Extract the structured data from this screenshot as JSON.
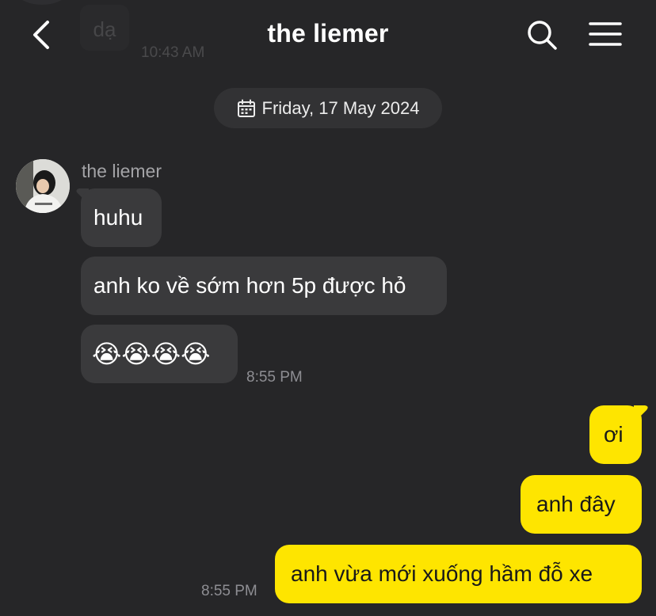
{
  "header": {
    "title": "the liemer",
    "icons": {
      "back": "chevron-left-icon",
      "search": "search-icon",
      "menu": "hamburger-menu-icon"
    }
  },
  "previous_message": {
    "text": "dạ",
    "time": "10:43 AM"
  },
  "date_separator": {
    "icon": "calendar-icon",
    "text": "Friday, 17 May 2024"
  },
  "incoming": {
    "sender": "the liemer",
    "messages": [
      {
        "text": "huhu"
      },
      {
        "text": "anh ko về sớm hơn 5p được hỏ"
      },
      {
        "text": "😭😭😭😭"
      }
    ],
    "time": "8:55 PM"
  },
  "outgoing": {
    "messages": [
      {
        "text": "ơi"
      },
      {
        "text": "anh đây"
      },
      {
        "text": "anh vừa mới xuống hầm đỗ xe"
      }
    ],
    "time": "8:55 PM"
  },
  "colors": {
    "background": "#262628",
    "incoming_bubble": "#3a3a3c",
    "outgoing_bubble": "#fee500"
  }
}
